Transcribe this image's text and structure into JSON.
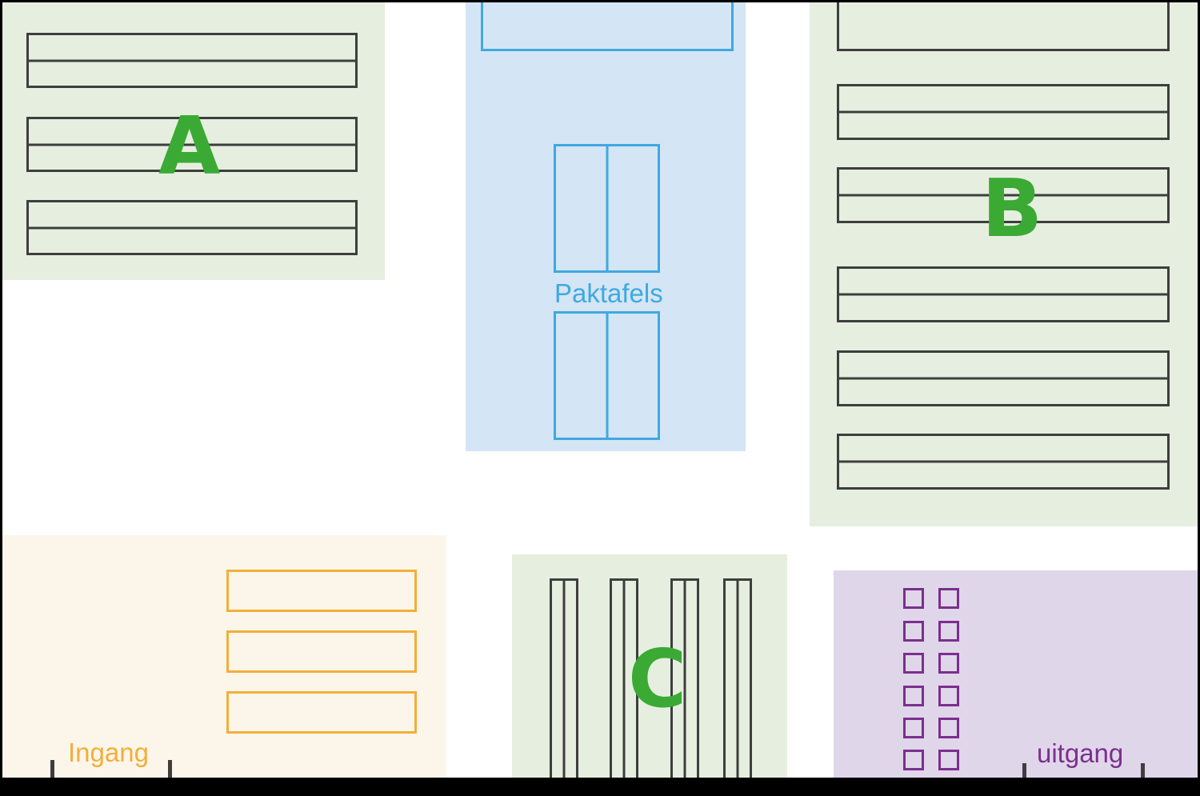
{
  "zones": {
    "a": {
      "letter": "A"
    },
    "b": {
      "letter": "B"
    },
    "c": {
      "letter": "C"
    }
  },
  "labels": {
    "packing": "Paktafels",
    "entrance": "Ingang",
    "exit": "uitgang"
  },
  "colors": {
    "storage_zone_fill": "#e6efdf",
    "packing_zone_fill": "#d4e5f5",
    "entrance_zone_fill": "#fcf6ea",
    "exit_zone_fill": "#e0d6ea",
    "zone_letter": "#3aaa35",
    "packing": "#3fa9e0",
    "entrance": "#f3ae3a",
    "exit": "#7b2f8e",
    "rack_outline": "#3e3e3e"
  }
}
